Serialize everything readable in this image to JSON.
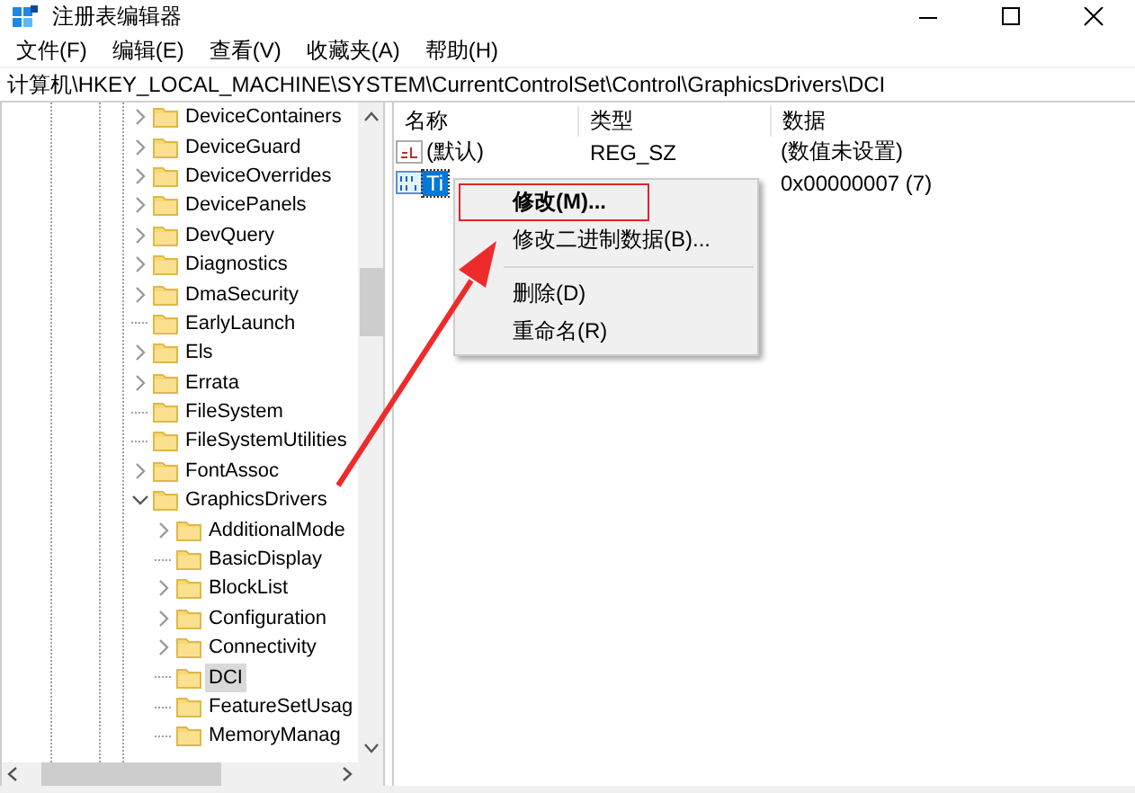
{
  "window": {
    "title": "注册表编辑器"
  },
  "menu_bar": [
    "文件(F)",
    "编辑(E)",
    "查看(V)",
    "收藏夹(A)",
    "帮助(H)"
  ],
  "address": "计算机\\HKEY_LOCAL_MACHINE\\SYSTEM\\CurrentControlSet\\Control\\GraphicsDrivers\\DCI",
  "tree": [
    {
      "label": "DeviceContainers",
      "kind": "node",
      "expanded": false,
      "selected": false
    },
    {
      "label": "DeviceGuard",
      "kind": "node",
      "expanded": false,
      "selected": false
    },
    {
      "label": "DeviceOverrides",
      "kind": "node",
      "expanded": false,
      "selected": false
    },
    {
      "label": "DevicePanels",
      "kind": "node",
      "expanded": false,
      "selected": false
    },
    {
      "label": "DevQuery",
      "kind": "node",
      "expanded": false,
      "selected": false
    },
    {
      "label": "Diagnostics",
      "kind": "node",
      "expanded": false,
      "selected": false
    },
    {
      "label": "DmaSecurity",
      "kind": "node",
      "expanded": false,
      "selected": false
    },
    {
      "label": "EarlyLaunch",
      "kind": "leaf",
      "selected": false
    },
    {
      "label": "Els",
      "kind": "node",
      "expanded": false,
      "selected": false
    },
    {
      "label": "Errata",
      "kind": "node",
      "expanded": false,
      "selected": false
    },
    {
      "label": "FileSystem",
      "kind": "leaf",
      "selected": false
    },
    {
      "label": "FileSystemUtilities",
      "kind": "leaf",
      "selected": false
    },
    {
      "label": "FontAssoc",
      "kind": "node",
      "expanded": false,
      "selected": false
    },
    {
      "label": "GraphicsDrivers",
      "kind": "node",
      "expanded": true,
      "selected": false,
      "children": [
        {
          "label": "AdditionalMode",
          "kind": "node",
          "expanded": false,
          "selected": false
        },
        {
          "label": "BasicDisplay",
          "kind": "leaf",
          "selected": false
        },
        {
          "label": "BlockList",
          "kind": "node",
          "expanded": false,
          "selected": false
        },
        {
          "label": "Configuration",
          "kind": "node",
          "expanded": false,
          "selected": false
        },
        {
          "label": "Connectivity",
          "kind": "node",
          "expanded": false,
          "selected": false
        },
        {
          "label": "DCI",
          "kind": "leaf",
          "selected": true
        },
        {
          "label": "FeatureSetUsag",
          "kind": "leaf",
          "selected": false
        },
        {
          "label": "MemoryManag",
          "kind": "leaf",
          "selected": false
        }
      ]
    }
  ],
  "table": {
    "columns": [
      "名称",
      "类型",
      "数据"
    ],
    "rows": [
      {
        "kind": "string",
        "name": "(默认)",
        "type": "REG_SZ",
        "data": "(数值未设置)",
        "selected": false
      },
      {
        "kind": "binary",
        "name": "Ti",
        "data": "0x00000007 (7)",
        "selected": true
      }
    ]
  },
  "context_menu": {
    "items": [
      {
        "kind": "item",
        "label": "修改(M)...",
        "default": true,
        "highlighted": true
      },
      {
        "kind": "item",
        "label": "修改二进制数据(B)...",
        "default": false,
        "highlighted": false
      },
      {
        "kind": "separator"
      },
      {
        "kind": "item",
        "label": "删除(D)",
        "default": false,
        "highlighted": false
      },
      {
        "kind": "item",
        "label": "重命名(R)",
        "default": false,
        "highlighted": false
      }
    ]
  },
  "annotation": {
    "kind": "arrow"
  }
}
